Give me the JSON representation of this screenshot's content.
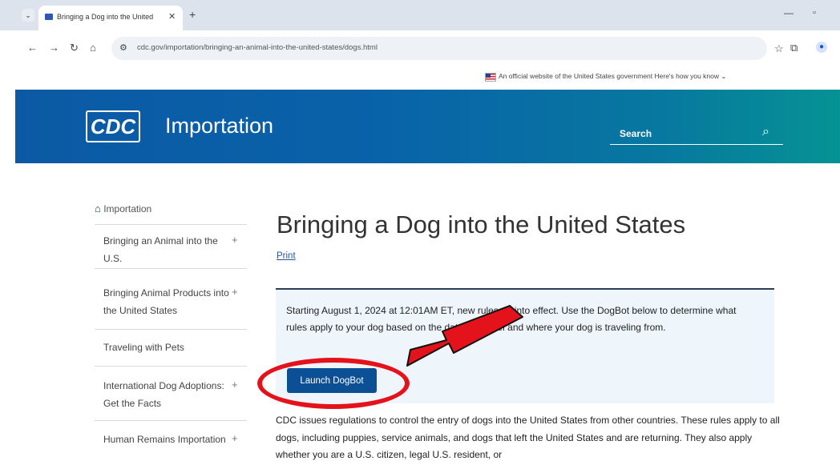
{
  "browser": {
    "tab_title": "Bringing a Dog into the United",
    "tab_close": "✕",
    "new_tab": "+",
    "url": "cdc.gov/importation/bringing-an-animal-into-the-united-states/dogs.html",
    "icons": [
      "tab-list-icon",
      "back-arrow-icon",
      "forward-arrow-icon",
      "reload-icon",
      "home-icon",
      "site-info-icon",
      "star-icon",
      "extensions-icon",
      "profile-icon",
      "minimize-icon",
      "restore-icon"
    ]
  },
  "gov_banner": {
    "text": "An official website of the United States government Here's how you know ⌄"
  },
  "header": {
    "logo": "CDC",
    "site_title": "Importation",
    "search_label": "Search",
    "colors": {
      "start": "#0b59a4",
      "end": "#069394"
    }
  },
  "sidebar": {
    "home": "Importation",
    "items": [
      {
        "label": "Bringing an Animal into the U.S.",
        "expandable": true
      },
      {
        "label": "Bringing Animal Products into the United States",
        "expandable": true
      },
      {
        "label": "Traveling with Pets",
        "expandable": false
      },
      {
        "label": "International Dog Adoptions: Get the Facts",
        "expandable": true
      },
      {
        "label": "Human Remains Importation",
        "expandable": true
      }
    ],
    "plus": "+"
  },
  "main": {
    "title": "Bringing a Dog into the United States",
    "print": "Print",
    "alert_text": "Starting August 1, 2024 at 12:01AM ET, new rules go into effect. Use the DogBot below to determine what rules apply to your dog based on the dates of travel and where your dog is traveling from.",
    "launch_button": "Launch DogBot",
    "body": "CDC issues regulations to control the entry of dogs into the United States from other countries. These rules apply to all dogs, including puppies, service animals, and dogs that left the United States and are returning. They also apply whether you are a U.S. citizen, legal U.S. resident, or"
  },
  "annotation": {
    "color": "#e4121b"
  }
}
